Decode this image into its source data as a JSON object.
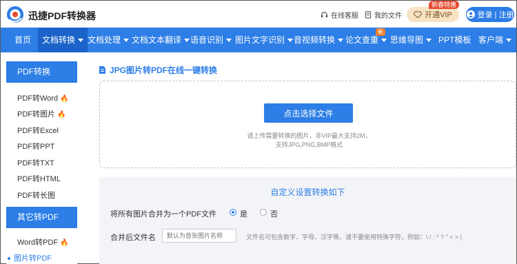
{
  "header": {
    "brand": "迅捷PDF转换器",
    "service": "在线客服",
    "files": "我的文件",
    "vip_badge": "新春特惠",
    "vip": "开通VIP",
    "login": "登录 | 注册"
  },
  "nav": {
    "items": [
      "首页",
      "文档转换",
      "文档处理",
      "文档文本翻译",
      "语音识别",
      "图片文字识别",
      "音视频转换",
      "论文查重",
      "思维导图",
      "PPT模板",
      "客户端"
    ],
    "new_badge": "新"
  },
  "sidebar": {
    "group1": "PDF转换",
    "group1_items": [
      "PDF转Word",
      "PDF转图片",
      "PDF转Excel",
      "PDF转PPT",
      "PDF转TXT",
      "PDF转HTML",
      "PDF转长图"
    ],
    "group2": "其它转PDF",
    "group2_items": [
      "Word转PDF",
      "图片转PDF"
    ]
  },
  "main": {
    "title": "JPG图片转PDF在线一键转换",
    "upload_button": "点击选择文件",
    "hint1": "请上传需要转换的图片，非VIP最大支持2M，",
    "hint2": "支持JPG,PNG,BMP格式"
  },
  "settings": {
    "title": "自定义设置转换如下",
    "merge_label": "将所有图片合并为一个PDF文件",
    "yes": "是",
    "no": "否",
    "filename_label": "合并后文件名",
    "filename_placeholder": "默认为首张图片名称",
    "filename_hint": "文件名可包含数字、字母、汉字等。请不要使用特殊字符，例如：\\ / : * ? \" < > |"
  },
  "colors": {
    "accent": "#2d7ee6",
    "fire": "#ef5b25",
    "vip": "#f6e3c4"
  }
}
